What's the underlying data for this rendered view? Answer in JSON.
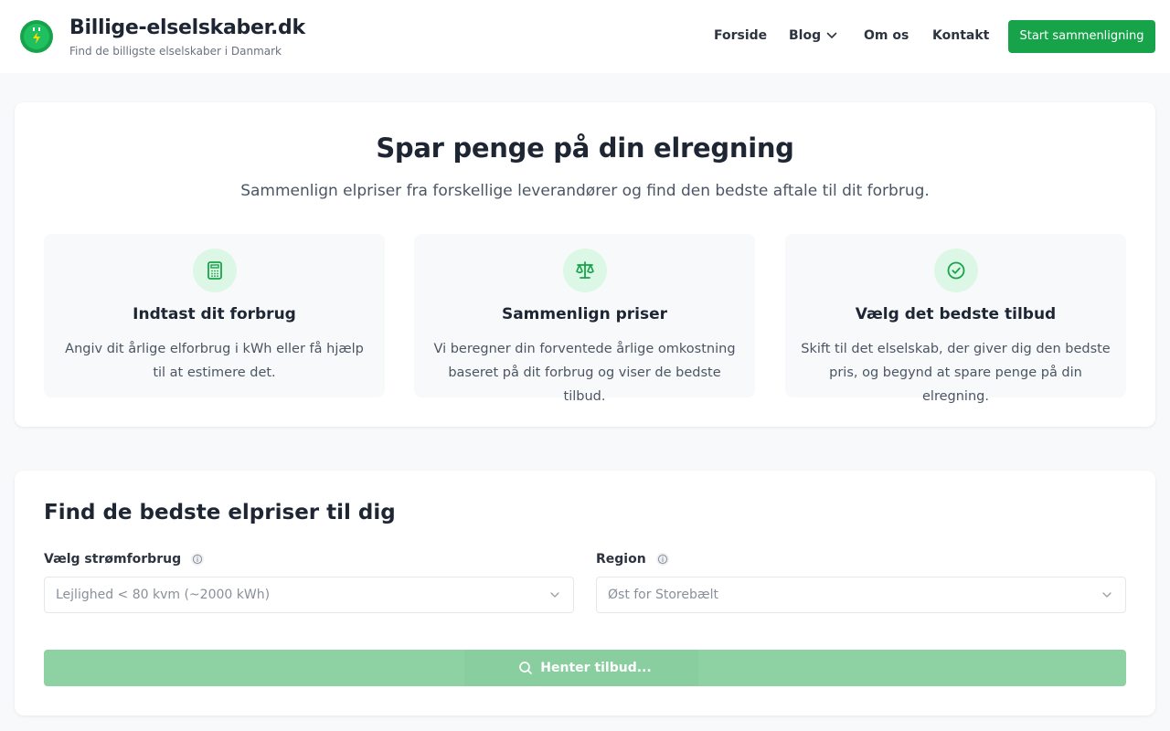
{
  "brand": {
    "title": "Billige-elselskaber.dk",
    "subtitle": "Find de billigste elselskaber i Danmark"
  },
  "nav": {
    "items": [
      "Forside",
      "Blog",
      "Om os",
      "Kontakt"
    ],
    "cta": "Start sammenligning"
  },
  "hero": {
    "title": "Spar penge på din elregning",
    "subtitle": "Sammenlign elpriser fra forskellige leverandører og find den bedste aftale til dit forbrug.",
    "features": [
      {
        "icon": "calculator-icon",
        "title": "Indtast dit forbrug",
        "description": "Angiv dit årlige elforbrug i kWh eller få hjælp til at estimere det."
      },
      {
        "icon": "scale-icon",
        "title": "Sammenlign priser",
        "description": "Vi beregner din forventede årlige omkostning baseret på dit forbrug og viser de bedste tilbud."
      },
      {
        "icon": "check-circle-icon",
        "title": "Vælg det bedste tilbud",
        "description": "Skift til det elselskab, der giver dig den bedste pris, og begynd at spare penge på din elregning."
      }
    ]
  },
  "finder": {
    "title": "Find de bedste elpriser til dig",
    "consumption": {
      "label": "Vælg strømforbrug",
      "value": "Lejlighed < 80 kvm (~2000 kWh)"
    },
    "region": {
      "label": "Region",
      "value": "Øst for Storebælt"
    },
    "search_button": "Henter tilbud..."
  },
  "colors": {
    "accent": "#17a34a",
    "accent_light": "#dcf7e6",
    "button_disabled": "#8ed1a3",
    "text_dark": "#1e2533",
    "text_muted": "#4b5563"
  }
}
